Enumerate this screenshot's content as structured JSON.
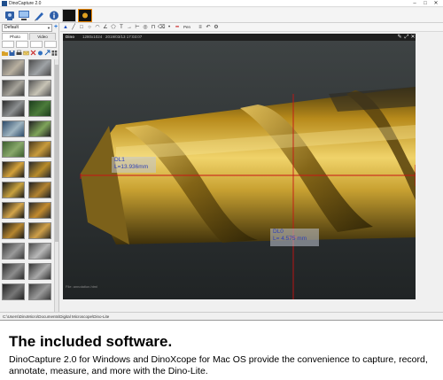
{
  "window": {
    "title": "DinoCapture 2.0",
    "controls": [
      "–",
      "□",
      "✕"
    ]
  },
  "toolbar": {
    "items": [
      "camera-icon",
      "computer-icon",
      "pen-icon",
      "info-icon",
      "live-view",
      "brightness-tool"
    ]
  },
  "left_panel": {
    "profile_value": "Default",
    "add_label": "+",
    "tabs": [
      "Photo",
      "Video"
    ],
    "file_tools": [
      "folder-icon",
      "save-icon",
      "print-icon",
      "email-icon",
      "delete-icon",
      "open-icon",
      "export-icon",
      "grid-icon"
    ],
    "thumbnails": [
      {
        "colors": [
          "#5a5a5a",
          "#b8b0a0"
        ]
      },
      {
        "colors": [
          "#4e4e4e",
          "#9fa3a6"
        ]
      },
      {
        "colors": [
          "#3c3c3c",
          "#a6a39a"
        ]
      },
      {
        "colors": [
          "#555",
          "#c8c4b6"
        ]
      },
      {
        "colors": [
          "#2b2b2b",
          "#8c8f90"
        ]
      },
      {
        "colors": [
          "#1d3d1d",
          "#4b7b3a"
        ]
      },
      {
        "colors": [
          "#2c4a6a",
          "#9fb4c0"
        ]
      },
      {
        "colors": [
          "#222",
          "#7fa45a"
        ]
      },
      {
        "colors": [
          "#3b5d2d",
          "#88a86a"
        ]
      },
      {
        "colors": [
          "#4a3a1e",
          "#c89b3c"
        ]
      },
      {
        "colors": [
          "#1b1b1b",
          "#d4a23a"
        ]
      },
      {
        "colors": [
          "#2a2a2a",
          "#b78b2a"
        ]
      },
      {
        "colors": [
          "#1b1b1b",
          "#c9a23e"
        ]
      },
      {
        "colors": [
          "#222",
          "#b28331"
        ]
      },
      {
        "colors": [
          "#151515",
          "#d4a54a"
        ]
      },
      {
        "colors": [
          "#2a2a2a",
          "#c28a2e"
        ]
      },
      {
        "colors": [
          "#1a1a1a",
          "#b6862f"
        ]
      },
      {
        "colors": [
          "#2e2a20",
          "#cfa04a"
        ]
      },
      {
        "colors": [
          "#3a3a3a",
          "#9a9a9a"
        ]
      },
      {
        "colors": [
          "#4a4a4a",
          "#b9b9b9"
        ]
      },
      {
        "colors": [
          "#2c2c2c",
          "#8d8d8d"
        ]
      },
      {
        "colors": [
          "#333",
          "#aaaaaa"
        ]
      },
      {
        "colors": [
          "#222",
          "#777"
        ]
      },
      {
        "colors": [
          "#3a3a3a",
          "#999"
        ]
      }
    ]
  },
  "viewer_toolbar": {
    "pen_label": "Pen"
  },
  "viewer": {
    "brand": "Dino",
    "resolution": "1280x1024",
    "timestamp": "2019/03/13 17:03:07",
    "caption": "File: annotation.html",
    "measurements": [
      {
        "name": "DL1",
        "value": "L=13.936mm"
      },
      {
        "name": "DL0",
        "value": "L= 4.575 mm"
      }
    ],
    "line_color": "#c81414",
    "label_color": "#2c3fb8"
  },
  "statusbar": {
    "path": "C:\\Users\\DinoMicro\\Documents\\Digital Microscope\\Dino-Lite"
  },
  "marketing": {
    "headline": "The included software.",
    "description": "DinoCapture 2.0 for Windows and DinoXcope for Mac OS provide the convenience to capture, record, annotate, measure, and more with the Dino-Lite."
  }
}
